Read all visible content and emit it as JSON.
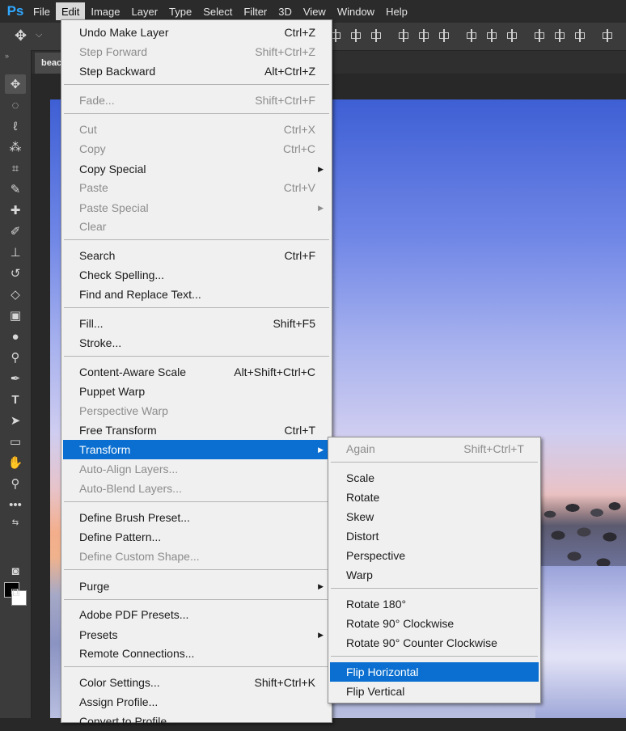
{
  "app": {
    "logo": "Ps"
  },
  "menubar": {
    "items": [
      "File",
      "Edit",
      "Image",
      "Layer",
      "Type",
      "Select",
      "Filter",
      "3D",
      "View",
      "Window",
      "Help"
    ],
    "active": "Edit"
  },
  "document": {
    "tab_label": "beac"
  },
  "edit_menu": {
    "items": [
      {
        "label": "Undo Make Layer",
        "shortcut": "Ctrl+Z",
        "disabled": false
      },
      {
        "label": "Step Forward",
        "shortcut": "Shift+Ctrl+Z",
        "disabled": true
      },
      {
        "label": "Step Backward",
        "shortcut": "Alt+Ctrl+Z",
        "disabled": false
      },
      {
        "label": "Fade...",
        "shortcut": "Shift+Ctrl+F",
        "disabled": true
      },
      {
        "label": "Cut",
        "shortcut": "Ctrl+X",
        "disabled": true
      },
      {
        "label": "Copy",
        "shortcut": "Ctrl+C",
        "disabled": true
      },
      {
        "label": "Copy Special",
        "shortcut": "",
        "disabled": false,
        "submenu": true
      },
      {
        "label": "Paste",
        "shortcut": "Ctrl+V",
        "disabled": true
      },
      {
        "label": "Paste Special",
        "shortcut": "",
        "disabled": true,
        "submenu": true
      },
      {
        "label": "Clear",
        "shortcut": "",
        "disabled": true
      },
      {
        "label": "Search",
        "shortcut": "Ctrl+F",
        "disabled": false
      },
      {
        "label": "Check Spelling...",
        "shortcut": "",
        "disabled": false
      },
      {
        "label": "Find and Replace Text...",
        "shortcut": "",
        "disabled": false
      },
      {
        "label": "Fill...",
        "shortcut": "Shift+F5",
        "disabled": false
      },
      {
        "label": "Stroke...",
        "shortcut": "",
        "disabled": false
      },
      {
        "label": "Content-Aware Scale",
        "shortcut": "Alt+Shift+Ctrl+C",
        "disabled": false
      },
      {
        "label": "Puppet Warp",
        "shortcut": "",
        "disabled": false
      },
      {
        "label": "Perspective Warp",
        "shortcut": "",
        "disabled": true
      },
      {
        "label": "Free Transform",
        "shortcut": "Ctrl+T",
        "disabled": false
      },
      {
        "label": "Transform",
        "shortcut": "",
        "disabled": false,
        "submenu": true,
        "highlighted": true
      },
      {
        "label": "Auto-Align Layers...",
        "shortcut": "",
        "disabled": true
      },
      {
        "label": "Auto-Blend Layers...",
        "shortcut": "",
        "disabled": true
      },
      {
        "label": "Define Brush Preset...",
        "shortcut": "",
        "disabled": false
      },
      {
        "label": "Define Pattern...",
        "shortcut": "",
        "disabled": false
      },
      {
        "label": "Define Custom Shape...",
        "shortcut": "",
        "disabled": true
      },
      {
        "label": "Purge",
        "shortcut": "",
        "disabled": false,
        "submenu": true
      },
      {
        "label": "Adobe PDF Presets...",
        "shortcut": "",
        "disabled": false
      },
      {
        "label": "Presets",
        "shortcut": "",
        "disabled": false,
        "submenu": true
      },
      {
        "label": "Remote Connections...",
        "shortcut": "",
        "disabled": false
      },
      {
        "label": "Color Settings...",
        "shortcut": "Shift+Ctrl+K",
        "disabled": false
      },
      {
        "label": "Assign Profile...",
        "shortcut": "",
        "disabled": false
      },
      {
        "label": "Convert to Profile...",
        "shortcut": "",
        "disabled": false
      }
    ]
  },
  "transform_submenu": {
    "items": [
      {
        "label": "Again",
        "shortcut": "Shift+Ctrl+T",
        "disabled": true
      },
      {
        "label": "Scale",
        "shortcut": "",
        "disabled": false
      },
      {
        "label": "Rotate",
        "shortcut": "",
        "disabled": false
      },
      {
        "label": "Skew",
        "shortcut": "",
        "disabled": false
      },
      {
        "label": "Distort",
        "shortcut": "",
        "disabled": false
      },
      {
        "label": "Perspective",
        "shortcut": "",
        "disabled": false
      },
      {
        "label": "Warp",
        "shortcut": "",
        "disabled": false
      },
      {
        "label": "Rotate 180°",
        "shortcut": "",
        "disabled": false
      },
      {
        "label": "Rotate 90° Clockwise",
        "shortcut": "",
        "disabled": false
      },
      {
        "label": "Rotate 90° Counter Clockwise",
        "shortcut": "",
        "disabled": false
      },
      {
        "label": "Flip Horizontal",
        "shortcut": "",
        "disabled": false,
        "highlighted": true
      },
      {
        "label": "Flip Vertical",
        "shortcut": "",
        "disabled": false
      }
    ]
  },
  "toolbar": {
    "tools": [
      "move-icon",
      "marquee-icon",
      "lasso-icon",
      "quick-select-icon",
      "crop-icon",
      "eyedropper-icon",
      "healing-brush-icon",
      "brush-icon",
      "clone-stamp-icon",
      "history-brush-icon",
      "eraser-icon",
      "gradient-icon",
      "blur-icon",
      "dodge-icon",
      "pen-icon",
      "type-icon",
      "path-select-icon",
      "rectangle-icon",
      "hand-icon",
      "zoom-icon",
      "more-tools-icon"
    ]
  },
  "colors": {
    "accent": "#0a6fd0",
    "menu_bg": "#f0f0f0",
    "disabled_text": "#8c8c8c",
    "ui_dark": "#2b2b2b"
  }
}
